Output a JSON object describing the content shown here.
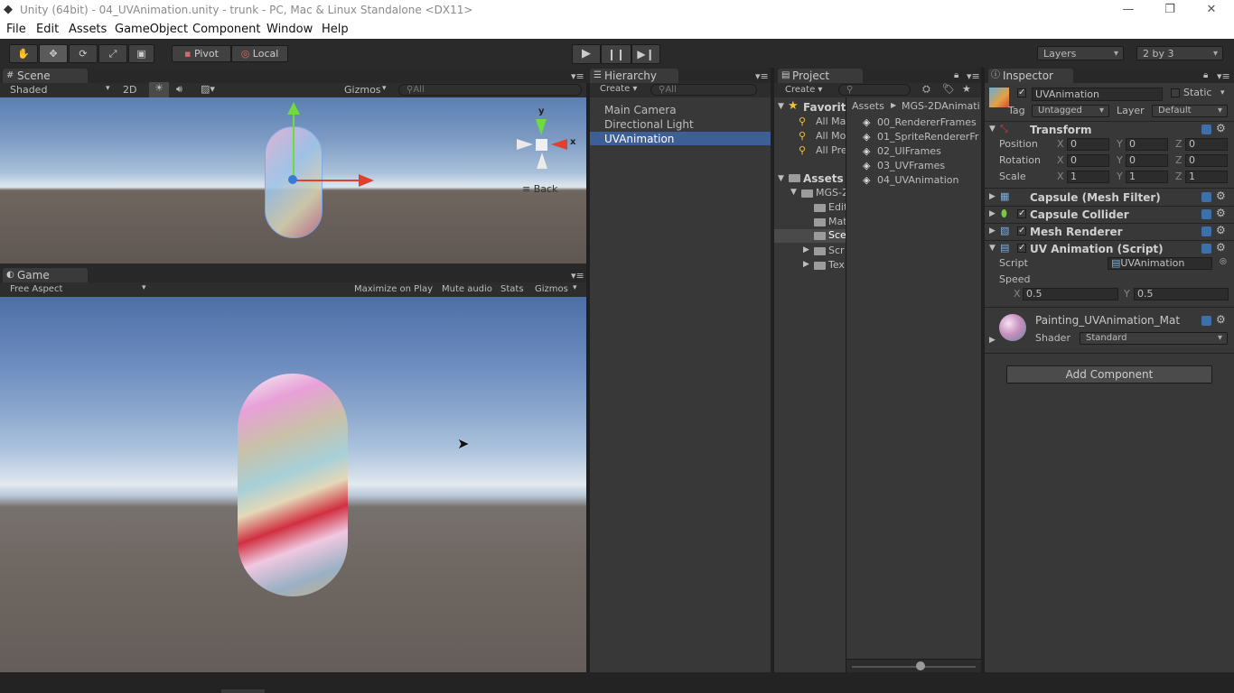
{
  "window": {
    "title": "Unity (64bit) - 04_UVAnimation.unity - trunk - PC, Mac & Linux Standalone <DX11>",
    "controls": [
      "—",
      "❐",
      "✕"
    ]
  },
  "menu": [
    "File",
    "Edit",
    "Assets",
    "GameObject",
    "Component",
    "Window",
    "Help"
  ],
  "toolbar": {
    "pivot": "Pivot",
    "local": "Local",
    "layers": "Layers",
    "layout": "2 by 3"
  },
  "scene": {
    "tab": "Scene",
    "shading": "Shaded",
    "mode2d": "2D",
    "gizmos": "Gizmos",
    "search_placeholder": "All",
    "gizmo_axis_y": "y",
    "gizmo_axis_x": "x",
    "gizmo_view": "Back"
  },
  "game": {
    "tab": "Game",
    "aspect": "Free Aspect",
    "maximize": "Maximize on Play",
    "mute": "Mute audio",
    "stats": "Stats",
    "gizmos": "Gizmos"
  },
  "hierarchy": {
    "tab": "Hierarchy",
    "create": "Create",
    "search_placeholder": "All",
    "items": [
      "Main Camera",
      "Directional Light",
      "UVAnimation"
    ],
    "selected": "UVAnimation"
  },
  "project": {
    "tab": "Project",
    "create": "Create",
    "favorites": "Favorit",
    "fav_items": [
      "All Ma",
      "All Mo",
      "All Pre"
    ],
    "assets": "Assets",
    "tree": [
      "MGS-2",
      "Edit",
      "Mat",
      "Sce",
      "Scr",
      "Tex"
    ],
    "breadcrumb": [
      "Assets",
      "MGS-2DAnimati"
    ],
    "files": [
      "00_RendererFrames",
      "01_SpriteRendererFr",
      "02_UIFrames",
      "03_UVFrames",
      "04_UVAnimation"
    ]
  },
  "inspector": {
    "tab": "Inspector",
    "object_name": "UVAnimation",
    "static_label": "Static",
    "tag_label": "Tag",
    "tag_value": "Untagged",
    "layer_label": "Layer",
    "layer_value": "Default",
    "transform": {
      "title": "Transform",
      "rows": [
        {
          "label": "Position",
          "x": "0",
          "y": "0",
          "z": "0"
        },
        {
          "label": "Rotation",
          "x": "0",
          "y": "0",
          "z": "0"
        },
        {
          "label": "Scale",
          "x": "1",
          "y": "1",
          "z": "1"
        }
      ],
      "axis_x": "X",
      "axis_y": "Y",
      "axis_z": "Z"
    },
    "components": [
      "Capsule (Mesh Filter)",
      "Capsule Collider",
      "Mesh Renderer",
      "UV Animation (Script)"
    ],
    "script_label": "Script",
    "script_value": "UVAnimation",
    "speed_label": "Speed",
    "speed_x_label": "X",
    "speed_x": "0.5",
    "speed_y_label": "Y",
    "speed_y": "0.5",
    "material_name": "Painting_UVAnimation_Mat",
    "shader_label": "Shader",
    "shader_value": "Standard",
    "add_component": "Add Component"
  },
  "colors": {
    "selection": "#3e5f96",
    "panel": "#383838",
    "toolbar": "#2a2a2a"
  }
}
